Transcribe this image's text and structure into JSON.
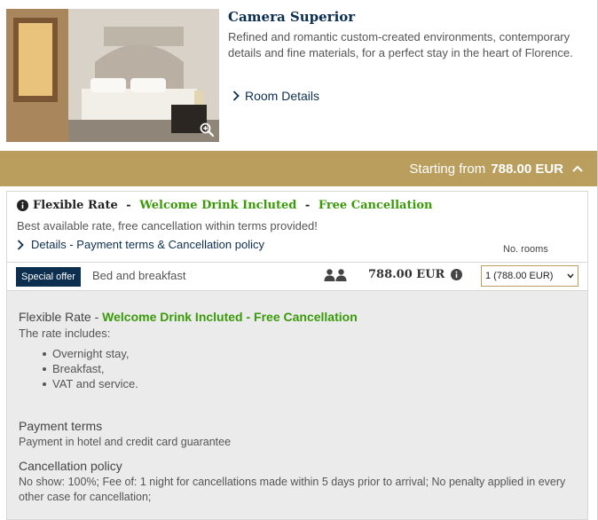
{
  "room": {
    "title": "Camera Superior",
    "description": "Refined and romantic custom-created environments, contemporary details and fine materials, for a perfect stay in the heart of Florence.",
    "details_link": "Room Details"
  },
  "price_bar": {
    "prefix": "Starting from",
    "amount": "788.00 EUR"
  },
  "rate": {
    "name": "Flexible Rate",
    "separator1": " - ",
    "highlight1": "Welcome Drink Incluted",
    "separator2": " - ",
    "highlight2": "Free Cancellation",
    "subtitle": "Best available rate, free cancellation within terms provided!",
    "details_link": "Details - Payment terms & Cancellation policy",
    "rooms_label": "No. rooms",
    "offer_badge": "Special offer",
    "board": "Bed and breakfast",
    "price": "788.00 EUR",
    "rooms_select_value": "1 (788.00 EUR)"
  },
  "rate_info": {
    "title_name": "Flexible Rate",
    "title_sep": " - ",
    "title_highlight": "Welcome Drink Incluted - Free Cancellation",
    "includes_label": "The rate includes:",
    "includes": [
      "Overnight stay,",
      "Breakfast,",
      "VAT and service."
    ],
    "payment_title": "Payment terms",
    "payment_text": "Payment in hotel and credit card guarantee",
    "cancellation_title": "Cancellation policy",
    "cancellation_text": "No show: 100%; Fee of: 1 night for cancellations made within 5 days prior to arrival; No penalty applied in every other case for cancellation;"
  },
  "colors": {
    "navy": "#0d2f4f",
    "gold": "#b99e5e",
    "green": "#3a9a0a"
  }
}
